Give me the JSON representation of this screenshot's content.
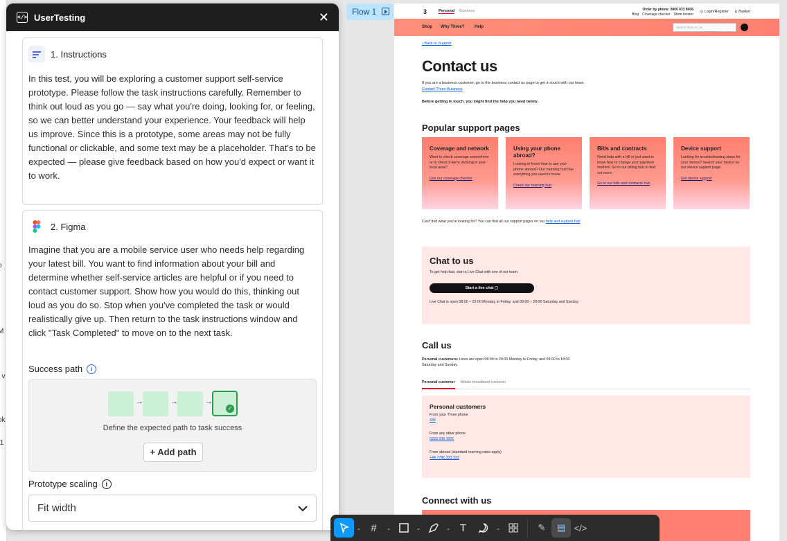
{
  "panel": {
    "title": "UserTesting",
    "instructions": {
      "heading": "1. Instructions",
      "body": "In this test, you will be exploring a customer support self-service prototype. Please follow the task instructions carefully. Remember to think out loud as you go — say what you're doing, looking for, or feeling, so we can better understand your experience. Your feedback will help us improve. Since this is a prototype, some areas may not be fully functional or clickable, and some text may be a placeholder. That's to be expected — please give feedback based on how you'd expect or want it to work."
    },
    "figma": {
      "heading": "2. Figma",
      "body": "Imagine that you are a mobile service user who needs help regarding your latest bill. You want to find information about your bill and determine whether self-service articles are helpful or if you need to contact customer support. Show how you would do this, thinking out loud as you do so. Stop when you've completed the task or would realistically give up. Then return to the task instructions window and click \"Task Completed\" to move on to the next task.",
      "success_path_label": "Success path",
      "success_path_hint": "Define the expected path to task success",
      "add_path": "+ Add path",
      "prototype_scaling_label": "Prototype scaling",
      "prototype_scaling_value": "Fit width"
    }
  },
  "canvas": {
    "flow_label": "Flow 1",
    "left_strip_fragments": [
      "p",
      "M",
      "t v",
      "ok",
      ".1"
    ]
  },
  "site": {
    "logo": "3",
    "segments": [
      "Personal",
      "Business"
    ],
    "phone": "Order by phone: 0800 033 8006",
    "toplinks": [
      "Blog",
      "Coverage checker",
      "Store locator"
    ],
    "login": "Login/Register",
    "basket": "Basket",
    "nav": [
      "Shop",
      "Why Three?",
      "Help"
    ],
    "search_placeholder": "Search three.co.uk",
    "back_link": "Back to Support",
    "title": "Contact us",
    "intro": "If you are a business customer, go to the business contact us page to get in touch with our team.",
    "intro_link": "Contact Three Business",
    "before": "Before getting in touch, you might find the help you need below.",
    "popular_heading": "Popular support pages",
    "cards": [
      {
        "title": "Coverage and network",
        "body": "Want to check coverage somewhere or to check if we're working in your local area?",
        "link": "Use our coverage checker"
      },
      {
        "title": "Using your phone abroad?",
        "body": "Looking to know how to use your phone abroad? Our roaming hub has everything you need to know.",
        "link": "Check our roaming hub"
      },
      {
        "title": "Bills and contracts",
        "body": "Need help with a bill or just want to know how to change your payment method. Go to our billing hub to find out more.",
        "link": "Go to our bills and contracts hub"
      },
      {
        "title": "Device support",
        "body": "Looking for troubleshooting steps for your device? Search your device on our device support page.",
        "link": "Get device support"
      }
    ],
    "cant_find": "Can't find what you're looking for? You can find all our support pages on our",
    "cant_find_link": "help and support hub",
    "chat": {
      "heading": "Chat to us",
      "sub": "To get help fast, start a Live Chat with one of our team.",
      "button": "Start a live chat",
      "hours": "Live Chat is open 08:00 – 22:00 Monday to Friday, and 09:00 – 20:00 Saturday and Sunday."
    },
    "call": {
      "heading": "Call us",
      "text_bold": "Personal customers:",
      "text": "Lines are open 08:00 to 20:00 Monday to Friday, and 09:00 to 18:00 Saturday and Sunday.",
      "tabs": [
        "Personal customer",
        "Mobile broadband customer"
      ],
      "box_title": "Personal customers",
      "rows": [
        {
          "label": "From your Three phone",
          "number": "333"
        },
        {
          "label": "From any other phone",
          "number": "0333 338 1001"
        },
        {
          "label": "From abroad (standard roaming rates apply)",
          "number": "+44 7782 333 333"
        }
      ]
    },
    "connect_heading": "Connect with us"
  },
  "toolbar": {
    "tools": [
      "move-icon",
      "frame-icon",
      "rectangle-icon",
      "pen-icon",
      "text-icon",
      "comment-icon",
      "components-icon"
    ],
    "modes": [
      "draw-icon",
      "design-icon",
      "dev-mode-icon"
    ]
  },
  "colors": {
    "accent": "#0d99ff",
    "brand_coral": "#ff8070",
    "panel_header": "#1e1e1e"
  }
}
